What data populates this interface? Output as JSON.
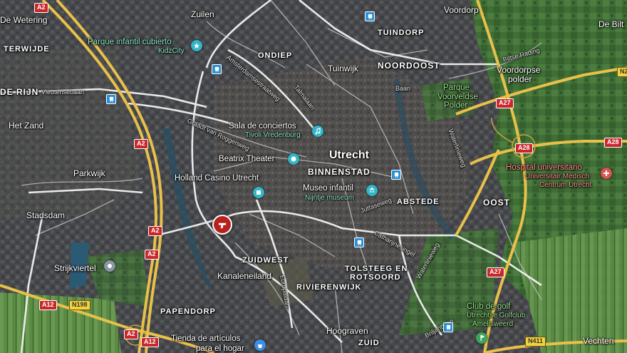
{
  "map": {
    "colors": {
      "urban": "#45474a",
      "green": "#3e6b35",
      "water": "#2b5a75",
      "major_road": "#e8c04a",
      "minor_road": "#c9c9c9",
      "marker": "#b7221e"
    },
    "districts": {
      "noordoost": "NOORDOOST",
      "binnenstad": "BINNENSTAD",
      "oost": "OOST",
      "zuidwest": "ZUIDWEST",
      "zuid": "ZUID",
      "tuindorp": "TUINDORP",
      "ondiep": "ONDIEP",
      "abstede": "ABSTEDE",
      "terwijde": "TERWIJDE",
      "papendorp": "PAPENDORP",
      "rivierenwijk": "RIVIERENWIJK",
      "tolsteeg_1": "TOLSTEEG EN",
      "tolsteeg_2": "ROTSOORD",
      "de_rijn": "DE RIJN"
    },
    "city": "Utrecht",
    "places": {
      "de_wetering": "De Wetering",
      "zuilen": "Zuilen",
      "voordorp": "Voordorp",
      "de_bilt": "De Bilt",
      "tuinwijk": "Tuinwijk",
      "voordorpse_polder_1": "Voordorpse",
      "voordorpse_polder_2": "polder",
      "het_zand": "Het Zand",
      "parkwijk": "Parkwijk",
      "stadsdam": "Stadsdam",
      "strijkviertel": "Strijkviertel",
      "kanaleneiland": "Kanaleneiland",
      "hoograven": "Hoograven",
      "vechten": "Vechten"
    },
    "pois": {
      "parque_infantil_1": "Parque infantil cubierto",
      "parque_infantil_2": "KidzCity",
      "sala_conciertos_1": "Sala de conciertos",
      "sala_conciertos_2": "Tivoli Vredenburg",
      "beatrix": "Beatrix Theater",
      "holland_casino": "Holland Casino Utrecht",
      "museo_1": "Museo infantil",
      "museo_2": "Nijntje museum",
      "parque_voorveldse_1": "Parque",
      "parque_voorveldse_2": "Voorveldse",
      "parque_voorveldse_3": "Polder",
      "hospital_1": "Hospital universitario",
      "hospital_2": "Universitair Medisch",
      "hospital_3": "Centrum Utrecht",
      "golf_1": "Club de golf",
      "golf_2": "Utrechtse Golfclub",
      "golf_3": "Amelisweerd",
      "tienda_1": "Tienda de artículos",
      "tienda_2": "para el hogar"
    },
    "streets": {
      "vleutensebaan": "Vleutensebaan",
      "amsterdamsestraatweg": "Amsterdamsestraatweg",
      "talmalaan": "Talmalaan",
      "graadt": "Graadt van Roggenweg",
      "biltse_rading": "Biltse Rading",
      "waterlinieweg_1": "Waterlinieweg",
      "waterlinieweg_2": "Waterlinieweg",
      "europalaan": "Europalaan",
      "catharijnesingel": "Catharijnesingel",
      "baan": "Baan",
      "briljantlaan": "Briljantlaan",
      "jutfaseweg": "Jutfaseweg"
    },
    "shields": {
      "a2_1": "A2",
      "a2_2": "A2",
      "a2_3": "A2",
      "a2_4": "A2",
      "a2_5": "A2",
      "a12_1": "A12",
      "a12_2": "A12",
      "n198": "N198",
      "a27_1": "A27",
      "a27_2": "A27",
      "a28_1": "A28",
      "a28_2": "A28",
      "n411": "N411",
      "n237": "N237"
    },
    "icons": {
      "marker": "gun-marker-icon",
      "poi_pin": "map-pin-icon",
      "transit": "train-station-icon"
    }
  }
}
